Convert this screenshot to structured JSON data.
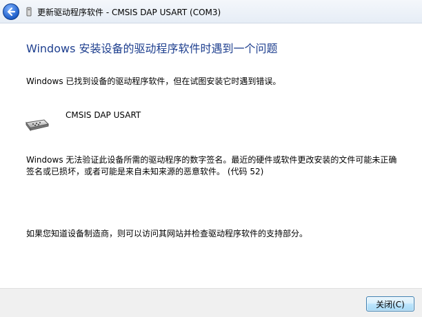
{
  "window": {
    "title": "更新驱动程序软件 - CMSIS DAP USART (COM3)"
  },
  "icons": {
    "back": "back-arrow-icon",
    "title_device": "device-icon",
    "device": "serial-port-device-icon"
  },
  "main": {
    "heading": "Windows 安装设备的驱动程序软件时遇到一个问题",
    "found_message": "Windows 已找到设备的驱动程序软件，但在试图安装它时遇到错误。",
    "device_name": "CMSIS DAP USART",
    "error_message": "Windows 无法验证此设备所需的驱动程序的数字签名。最近的硬件或软件更改安装的文件可能未正确签名或已损坏，或者可能是来自未知来源的恶意软件。 (代码 52)",
    "help_message": "如果您知道设备制造商，则可以访问其网站并检查驱动程序软件的支持部分。"
  },
  "footer": {
    "close_label": "关闭(C)"
  },
  "colors": {
    "heading": "#1e3f8f",
    "footer_bg": "#f0f0f0",
    "button_border": "#3c7fb1"
  }
}
